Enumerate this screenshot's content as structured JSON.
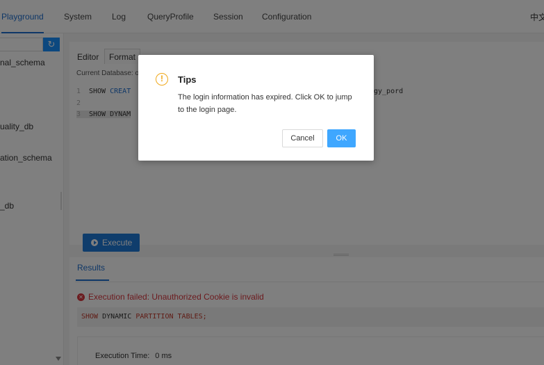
{
  "nav": {
    "tabs": [
      "Playground",
      "System",
      "Log",
      "QueryProfile",
      "Session",
      "Configuration"
    ],
    "active_tab": "Playground",
    "language": "中文"
  },
  "sidebar": {
    "refresh_icon": "refresh-icon",
    "items": [
      "nal_schema",
      "uality_db",
      "ation_schema",
      "_db"
    ]
  },
  "editor": {
    "tabs": [
      "Editor",
      "Format"
    ],
    "current_database_label": "Current Database: oc",
    "lines": [
      {
        "num": "1",
        "parts": [
          "SHOW ",
          "CREAT"
        ],
        "tail": "gy_pord"
      },
      {
        "num": "2",
        "parts": [
          ""
        ],
        "tail": ""
      },
      {
        "num": "3",
        "parts": [
          "SHOW DYNAM"
        ],
        "tail": ""
      }
    ],
    "execute_label": "Execute"
  },
  "results": {
    "tab_label": "Results",
    "error_message": "Execution failed: Unauthorized Cookie is invalid",
    "sql": {
      "show": "SHOW",
      "dynamic": "DYNAMIC",
      "partition": "PARTITION",
      "tables": "TABLES;"
    },
    "exec_time_label": "Execution Time:",
    "exec_time_value": "0 ms"
  },
  "modal": {
    "title": "Tips",
    "message": "The login information has expired. Click OK to jump to the login page.",
    "cancel_label": "Cancel",
    "ok_label": "OK",
    "icon": "warning-icon"
  },
  "colors": {
    "accent": "#1f6fcf",
    "primary_button": "#1f7ad8",
    "ok_button": "#3fa7ff",
    "error": "#d9363e",
    "warning": "#f0a81a"
  }
}
